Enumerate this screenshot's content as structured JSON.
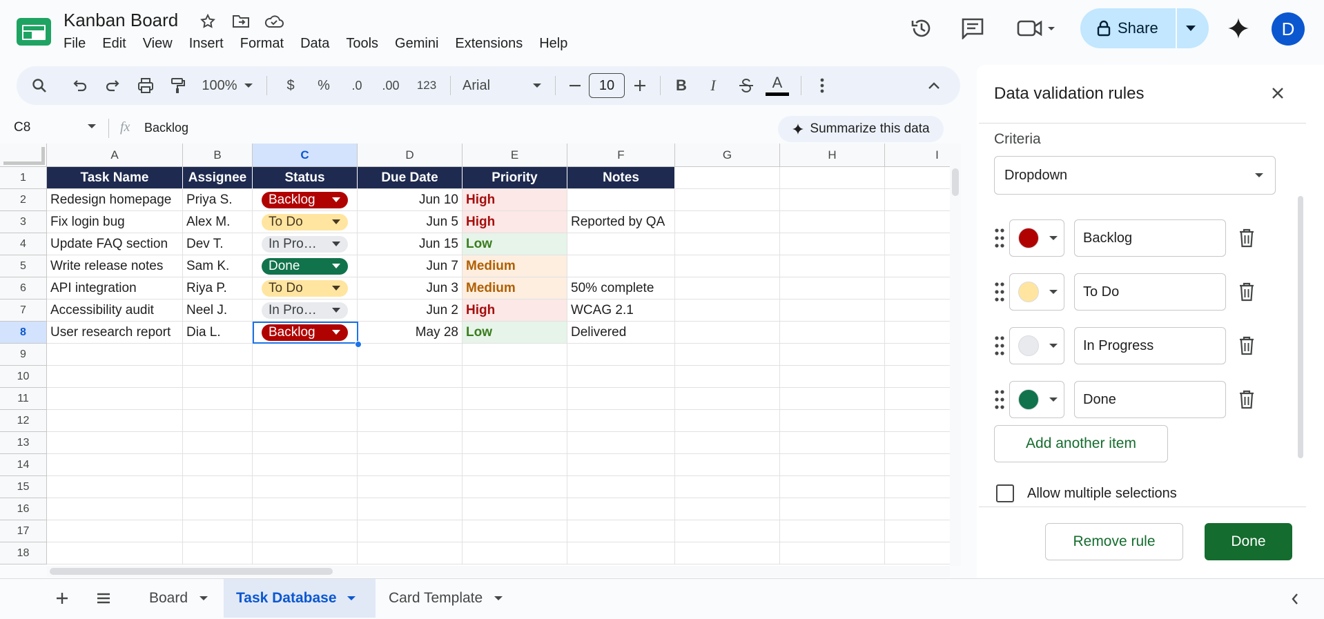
{
  "app": {
    "title": "Kanban Board",
    "menu": [
      "File",
      "Edit",
      "View",
      "Insert",
      "Format",
      "Data",
      "Tools",
      "Gemini",
      "Extensions",
      "Help"
    ],
    "share_label": "Share",
    "avatar_letter": "D"
  },
  "toolbar": {
    "zoom": "100%",
    "currency": "$",
    "percent": "%",
    "dec_decrease": ".0",
    "dec_increase": ".00",
    "number_format": "123",
    "font": "Arial",
    "font_size": "10",
    "bold": "B",
    "italic": "I",
    "text_color": "A"
  },
  "formula_bar": {
    "cell_ref": "C8",
    "fx": "fx",
    "value": "Backlog",
    "summarize": "Summarize this data"
  },
  "columns": [
    "A",
    "B",
    "C",
    "D",
    "E",
    "F",
    "G",
    "H",
    "I"
  ],
  "rows": [
    "1",
    "2",
    "3",
    "4",
    "5",
    "6",
    "7",
    "8",
    "9",
    "10",
    "11",
    "12",
    "13",
    "14",
    "15",
    "16",
    "17",
    "18"
  ],
  "table": {
    "headers": [
      "Task Name",
      "Assignee",
      "Status",
      "Due Date",
      "Priority",
      "Notes"
    ],
    "rows": [
      {
        "task": "Redesign homepage",
        "assignee": "Priya S.",
        "status": "Backlog",
        "due": "Jun 10",
        "priority": "High",
        "notes": ""
      },
      {
        "task": "Fix login bug",
        "assignee": "Alex M.",
        "status": "To Do",
        "due": "Jun 5",
        "priority": "High",
        "notes": "Reported by QA"
      },
      {
        "task": "Update FAQ section",
        "assignee": "Dev T.",
        "status": "In Pro…",
        "due": "Jun 15",
        "priority": "Low",
        "notes": ""
      },
      {
        "task": "Write release notes",
        "assignee": "Sam K.",
        "status": "Done",
        "due": "Jun 7",
        "priority": "Medium",
        "notes": ""
      },
      {
        "task": "API integration",
        "assignee": "Riya P.",
        "status": "To Do",
        "due": "Jun 3",
        "priority": "Medium",
        "notes": "50% complete"
      },
      {
        "task": "Accessibility audit",
        "assignee": "Neel J.",
        "status": "In Pro…",
        "due": "Jun 2",
        "priority": "High",
        "notes": "WCAG 2.1"
      },
      {
        "task": "User research report",
        "assignee": "Dia L.",
        "status": "Backlog",
        "due": "May 28",
        "priority": "Low",
        "notes": "Delivered"
      }
    ]
  },
  "status_colors": {
    "Backlog": {
      "bg": "#b10202",
      "fg": "#ffffff"
    },
    "To Do": {
      "bg": "#ffe5a0",
      "fg": "#473821"
    },
    "In Pro…": {
      "bg": "#e8eaed",
      "fg": "#3c4043"
    },
    "Done": {
      "bg": "#11734b",
      "fg": "#ffffff"
    }
  },
  "sheet_tabs": [
    "Board",
    "Task Database",
    "Card Template"
  ],
  "active_tab": "Task Database",
  "panel": {
    "title": "Data validation rules",
    "criteria_label": "Criteria",
    "criteria_value": "Dropdown",
    "items": [
      {
        "label": "Backlog",
        "color": "#b10202"
      },
      {
        "label": "To Do",
        "color": "#ffe5a0"
      },
      {
        "label": "In Progress",
        "color": "#e8eaed"
      },
      {
        "label": "Done",
        "color": "#11734b"
      }
    ],
    "add_item": "Add another item",
    "allow_multiple": "Allow multiple selections",
    "remove_rule": "Remove rule",
    "done": "Done"
  }
}
